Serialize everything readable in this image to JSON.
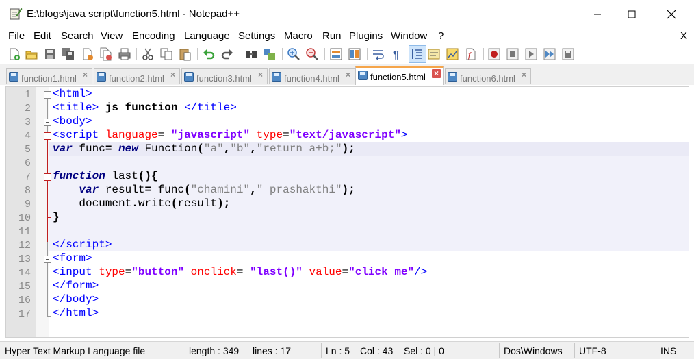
{
  "window": {
    "title": "E:\\blogs\\java script\\function5.html - Notepad++",
    "minimize": "—",
    "maximize": "☐",
    "close": "✕"
  },
  "menu": {
    "items": [
      "File",
      "Edit",
      "Search",
      "View",
      "Encoding",
      "Language",
      "Settings",
      "Macro",
      "Run",
      "Plugins",
      "Window",
      "?"
    ],
    "close_doc": "X"
  },
  "toolbar": {
    "icons": [
      "new-file-icon",
      "open-file-icon",
      "save-icon",
      "save-all-icon",
      "close-icon",
      "close-all-icon",
      "print-icon",
      "cut-icon",
      "copy-icon",
      "paste-icon",
      "undo-icon",
      "redo-icon",
      "find-icon",
      "replace-icon",
      "zoom-in-icon",
      "zoom-out-icon",
      "sync-vertical-icon",
      "sync-horizontal-icon",
      "word-wrap-icon",
      "show-all-chars-icon",
      "indent-guide-icon",
      "function-list-icon",
      "doc-map-icon",
      "record-macro-icon",
      "stop-macro-icon",
      "play-macro-icon",
      "run-macro-multiple-icon",
      "save-macro-icon"
    ]
  },
  "tabs": [
    {
      "label": "function1.html",
      "active": false
    },
    {
      "label": "function2.html",
      "active": false
    },
    {
      "label": "function3.html",
      "active": false
    },
    {
      "label": "function4.html",
      "active": false
    },
    {
      "label": "function5.html",
      "active": true
    },
    {
      "label": "function6.html",
      "active": false
    }
  ],
  "editor": {
    "line_numbers": [
      "1",
      "2",
      "3",
      "4",
      "5",
      "6",
      "7",
      "8",
      "9",
      "10",
      "11",
      "12",
      "13",
      "14",
      "15",
      "16",
      "17"
    ],
    "current_line": 5
  },
  "status": {
    "file_type": "Hyper Text Markup Language file",
    "length": "length : 349",
    "lines": "lines : 17",
    "ln": "Ln : 5",
    "col": "Col : 43",
    "sel": "Sel : 0 | 0",
    "eol": "Dos\\Windows",
    "encoding": "UTF-8",
    "mode": "INS"
  },
  "colors": {
    "tag": "#0000ff",
    "attribute": "#ff0000",
    "string": "#8000ff",
    "keyword": "#000080",
    "active_tab_accent": "#f5a54a",
    "current_line": "#eaeaf6"
  }
}
